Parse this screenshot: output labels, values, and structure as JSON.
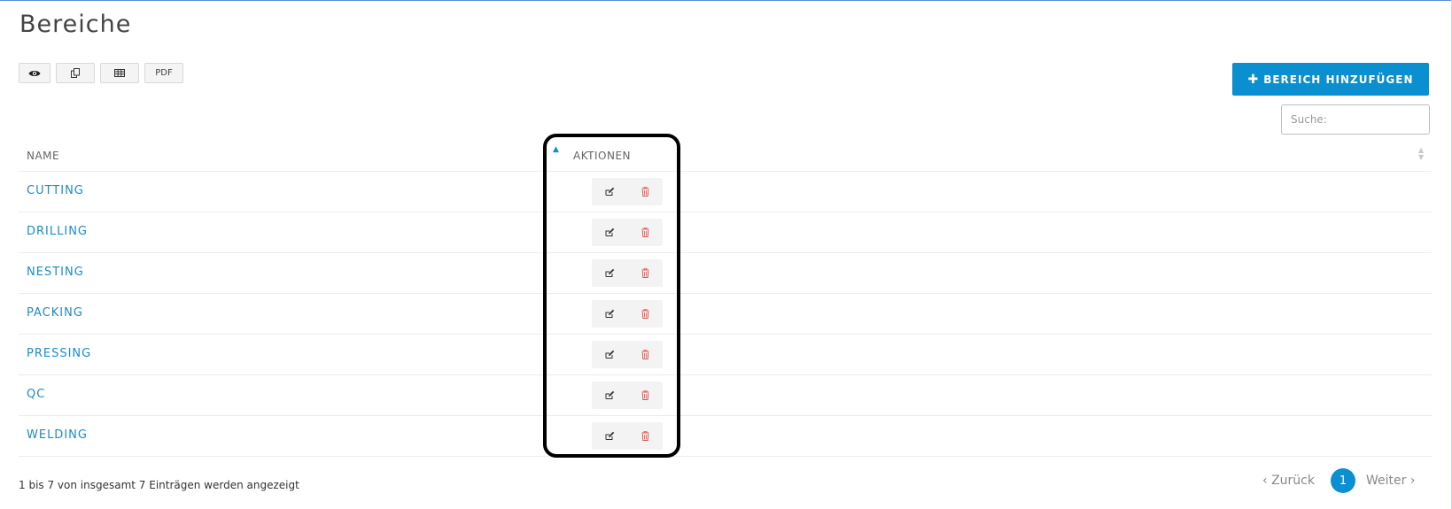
{
  "page": {
    "title": "Bereiche"
  },
  "toolbar": {
    "buttons": [
      {
        "icon": "eye-icon"
      },
      {
        "icon": "copy-icon"
      },
      {
        "icon": "table-icon"
      },
      {
        "label": "PDF"
      }
    ]
  },
  "add_button": {
    "label": "BEREICH HINZUFÜGEN",
    "icon": "plus-icon"
  },
  "search": {
    "placeholder": "Suche:",
    "value": ""
  },
  "table": {
    "headers": [
      "NAME",
      "AKTIONEN"
    ],
    "sort": {
      "column": "NAME",
      "direction": "ascending"
    },
    "rows": [
      {
        "name": "CUTTING"
      },
      {
        "name": "DRILLING"
      },
      {
        "name": "NESTING"
      },
      {
        "name": "PACKING"
      },
      {
        "name": "PRESSING"
      },
      {
        "name": "QC"
      },
      {
        "name": "WELDING"
      }
    ],
    "row_actions": [
      {
        "icon": "edit-icon"
      },
      {
        "icon": "trash-icon",
        "color": "#e25656"
      }
    ]
  },
  "footer": {
    "info": "1 bis 7 von insgesamt 7 Einträgen werden angezeigt"
  },
  "pagination": {
    "prev": "Zurück",
    "current": "1",
    "next": "Weiter"
  },
  "colors": {
    "accent": "#0a8fd1",
    "link": "#1a8cc8",
    "delete": "#e25656",
    "highlight": "#000000"
  }
}
